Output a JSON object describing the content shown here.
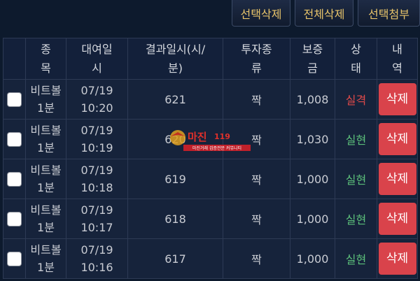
{
  "toolbar": {
    "select_delete": "선택삭제",
    "delete_all": "전체삭제",
    "select_attach": "선택첨부"
  },
  "columns": {
    "type": [
      "종",
      "목"
    ],
    "date": [
      "대여일",
      "시"
    ],
    "result_time": [
      "결과일시(시/",
      "분)"
    ],
    "bet_kind": [
      "투자종",
      "류"
    ],
    "deposit": [
      "보증",
      "금"
    ],
    "status": [
      "상",
      "태"
    ],
    "details": [
      "내",
      "역"
    ]
  },
  "rows": [
    {
      "game": [
        "비트볼",
        "1분"
      ],
      "datetime": [
        "07/19",
        "10:20"
      ],
      "round": "621",
      "bet": "짝",
      "amount": "1,008",
      "status": "실격",
      "status_color": "#e04a4a",
      "action": "삭제"
    },
    {
      "game": [
        "비트볼",
        "1분"
      ],
      "datetime": [
        "07/19",
        "10:19"
      ],
      "round": "620",
      "bet": "짝",
      "amount": "1,030",
      "status": "실현",
      "status_color": "#5cc07a",
      "action": "삭제"
    },
    {
      "game": [
        "비트볼",
        "1분"
      ],
      "datetime": [
        "07/19",
        "10:18"
      ],
      "round": "619",
      "bet": "짝",
      "amount": "1,000",
      "status": "실현",
      "status_color": "#5cc07a",
      "action": "삭제"
    },
    {
      "game": [
        "비트볼",
        "1분"
      ],
      "datetime": [
        "07/19",
        "10:17"
      ],
      "round": "618",
      "bet": "짝",
      "amount": "1,000",
      "status": "실현",
      "status_color": "#5cc07a",
      "action": "삭제"
    },
    {
      "game": [
        "비트볼",
        "1분"
      ],
      "datetime": [
        "07/19",
        "10:16"
      ],
      "round": "617",
      "bet": "짝",
      "amount": "1,000",
      "status": "실현",
      "status_color": "#5cc07a",
      "action": "삭제"
    }
  ],
  "watermark": {
    "logo_text": "마진",
    "tagline": "마진거래 검증전문 커뮤니티"
  }
}
